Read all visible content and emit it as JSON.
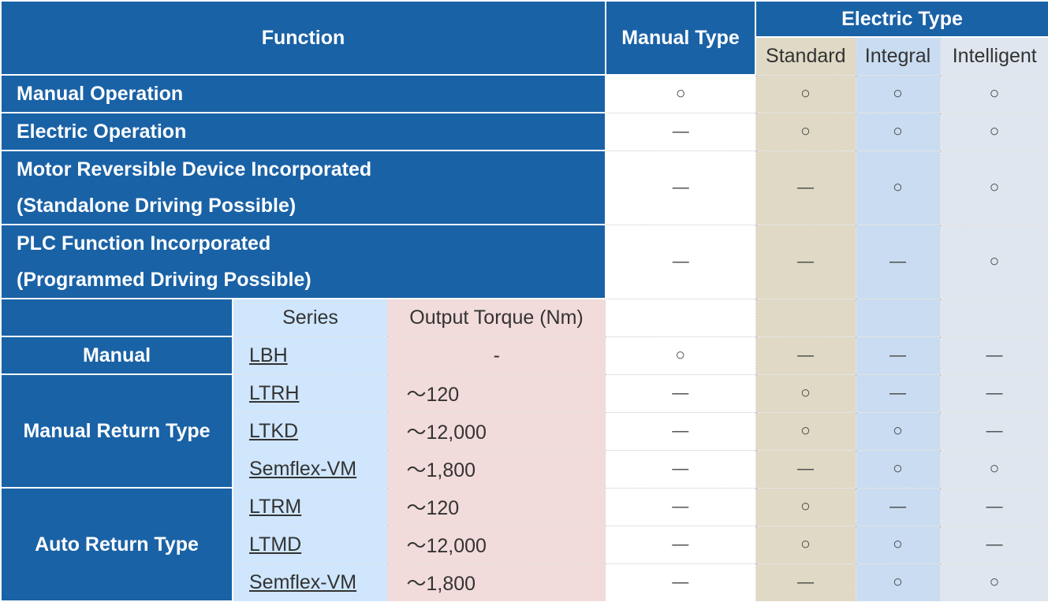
{
  "header": {
    "function": "Function",
    "manual_type": "Manual Type",
    "electric_type": "Electric Type",
    "standard": "Standard",
    "integral": "Integral",
    "intelligent": "Intelligent"
  },
  "functions": [
    {
      "lines": [
        "Manual Operation"
      ],
      "manual": "○",
      "standard": "○",
      "integral": "○",
      "intelligent": "○"
    },
    {
      "lines": [
        "Electric Operation"
      ],
      "manual": "—",
      "standard": "○",
      "integral": "○",
      "intelligent": "○"
    },
    {
      "lines": [
        "Motor Reversible Device Incorporated",
        "(Standalone Driving Possible)"
      ],
      "manual": "—",
      "standard": "—",
      "integral": "○",
      "intelligent": "○"
    },
    {
      "lines": [
        "PLC Function Incorporated",
        "(Programmed Driving Possible)"
      ],
      "manual": "—",
      "standard": "—",
      "integral": "—",
      "intelligent": "○"
    }
  ],
  "series_header": {
    "series": "Series",
    "output_torque": "Output Torque (Nm)"
  },
  "groups": [
    {
      "label": "Manual",
      "rows": [
        {
          "series": "LBH",
          "torque": "-",
          "manual": "○",
          "standard": "—",
          "integral": "—",
          "intelligent": "—"
        }
      ]
    },
    {
      "label": "Manual Return Type",
      "rows": [
        {
          "series": "LTRH",
          "torque": "～120",
          "manual": "—",
          "standard": "○",
          "integral": "—",
          "intelligent": "—"
        },
        {
          "series": "LTKD",
          "torque": "～12,000",
          "manual": "—",
          "standard": "○",
          "integral": "○",
          "intelligent": "—"
        },
        {
          "series": "Semflex-VM",
          "torque": "～1,800",
          "manual": "—",
          "standard": "—",
          "integral": "○",
          "intelligent": "○"
        }
      ]
    },
    {
      "label": "Auto Return Type",
      "rows": [
        {
          "series": "LTRM",
          "torque": "～120",
          "manual": "—",
          "standard": "○",
          "integral": "—",
          "intelligent": "—"
        },
        {
          "series": "LTMD",
          "torque": "～12,000",
          "manual": "—",
          "standard": "○",
          "integral": "○",
          "intelligent": "—"
        },
        {
          "series": "Semflex-VM",
          "torque": "～1,800",
          "manual": "—",
          "standard": "—",
          "integral": "○",
          "intelligent": "○"
        }
      ]
    }
  ]
}
